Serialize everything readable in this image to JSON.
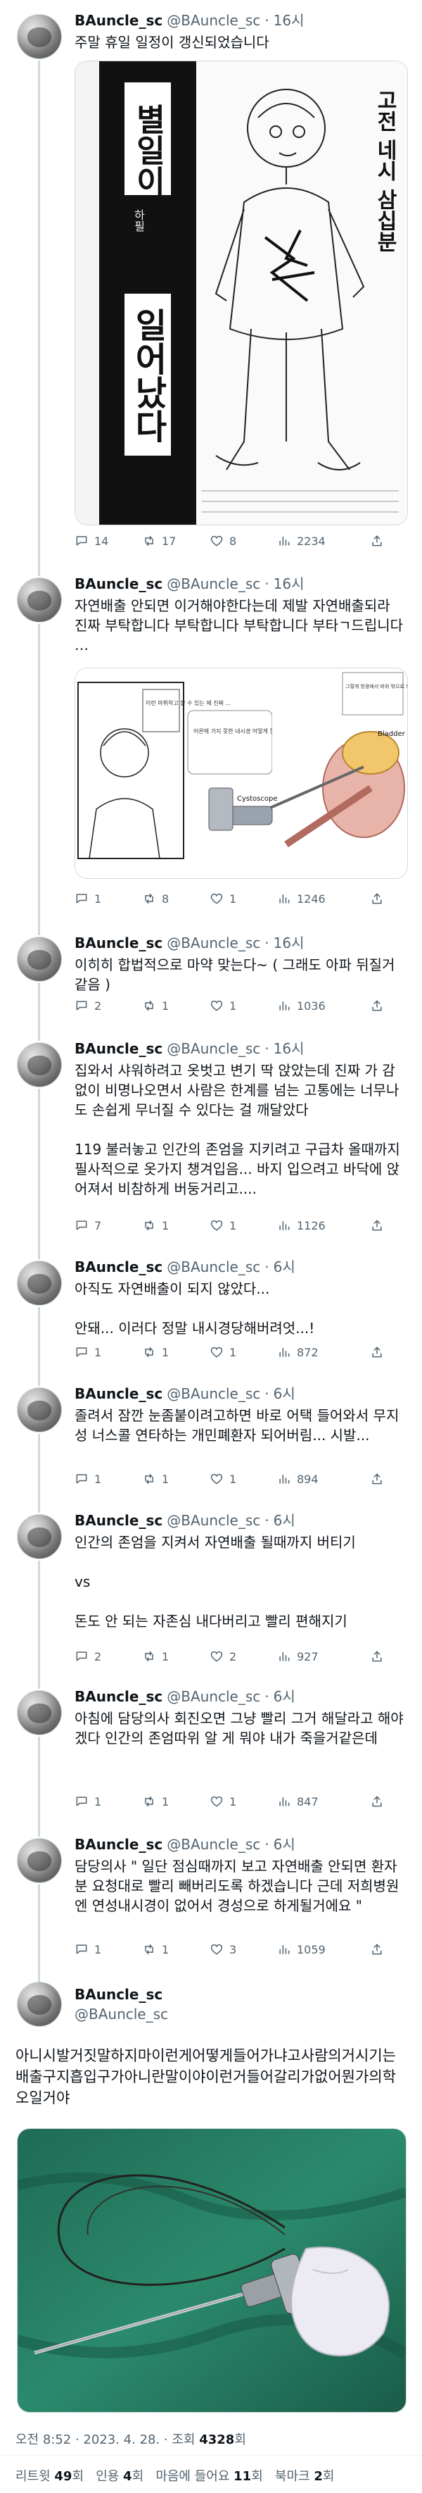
{
  "author": {
    "name": "BAuncle_sc",
    "handle": "@BAuncle_sc"
  },
  "tweets": [
    {
      "time": "16시",
      "text": "주말 휴일 일정이 갱신되었습니다",
      "image": {
        "big_title": "별일이",
        "sub_title": "일어났다",
        "side_text": "고전 네시 삼십분",
        "small_note": "하필"
      },
      "replies": "14",
      "retweets": "17",
      "likes": "8",
      "views": "2234"
    },
    {
      "time": "16시",
      "text": "자연배출 안되면 이거해야한다는데 제발 자연배출되라 진짜 부탁합니다 부탁합니다 부탁합니다 부타ㄱ드립니다 …",
      "image": {
        "panel_text_1": "이런 마취하고 할 수 있는 제 진짜 ...",
        "panel_text_2": "어른에 가지 못한 내시경 어떻게 못 하...",
        "panel_text_3": "그렇게 방광에서 바위 밖으로 퇴석 거려 보는",
        "label_cystoscope": "Cystoscope",
        "label_bladder": "Bladder"
      },
      "replies": "1",
      "retweets": "8",
      "likes": "1",
      "views": "1246"
    },
    {
      "time": "16시",
      "text": "이히히 합법적으로 마약 맞는다~ ( 그래도 아파 뒤질거같음 )",
      "replies": "2",
      "retweets": "1",
      "likes": "1",
      "views": "1036"
    },
    {
      "time": "16시",
      "text": "집와서 샤워하려고 옷벗고 변기 딱 앉았는데 진짜 가 감없이 비명나오면서 사람은 한계를 넘는 고통에는 너무나도 손쉽게 무너질 수 있다는 걸 깨달았다\n\n119 불러놓고 인간의 존엄을 지키려고 구급차 올때까지 필사적으로 옷가지 챙겨입음... 바지 입으려고 바닥에 앉어져서 비참하게 버둥거리고....",
      "replies": "7",
      "retweets": "1",
      "likes": "1",
      "views": "1126"
    },
    {
      "time": "6시",
      "text": "아직도 자연배출이 되지 않았다...\n\n안돼... 이러다 정말 내시경당해버려엇...!",
      "replies": "1",
      "retweets": "1",
      "likes": "1",
      "views": "872"
    },
    {
      "time": "6시",
      "text": "졸려서 잠깐 눈좀붙이려고하면 바로 어택 들어와서 무지성 너스콜 연타하는 개민폐환자 되어버림... 시발...",
      "replies": "1",
      "retweets": "1",
      "likes": "1",
      "views": "894"
    },
    {
      "time": "6시",
      "text": "인간의 존엄을 지켜서 자연배출 될때까지 버티기\n\nvs\n\n돈도 안 되는 자존심 내다버리고 빨리 편해지기",
      "replies": "2",
      "retweets": "1",
      "likes": "2",
      "views": "927"
    },
    {
      "time": "6시",
      "text": "아침에 담당의사 회진오면 그냥 빨리 그거 해달라고 해야겠다 인간의 존엄따위 알 게 뭐야 내가 죽을거같은데",
      "replies": "1",
      "retweets": "1",
      "likes": "1",
      "views": "847"
    },
    {
      "time": "6시",
      "text": "담당의사 \" 일단 점심때까지 보고 자연배출 안되면 환자분 요청대로 빨리 빼버리도록 하겠습니다 근데 저희병원엔 연성내시경이 없어서 경성으로 하게될거에요 \"",
      "replies": "1",
      "retweets": "1",
      "likes": "3",
      "views": "1059"
    }
  ],
  "final": {
    "text": "아니시발거짓말하지마이런게어떻게들어가냐고사람의거시기는배출구지흡입구가아니란말이야이런거들어갈리가없어뭔가의학오일거야",
    "timestamp": "오전 8:52 · 2023. 4. 28. · 조회 ",
    "views_count": "4328",
    "views_suffix": "회",
    "stats": {
      "retweets_label": "리트윗 ",
      "retweets": "49",
      "retweets_unit": "회",
      "quotes_label": "인용 ",
      "quotes": "4",
      "quotes_unit": "회",
      "likes_label": "마음에 들어요 ",
      "likes": "11",
      "likes_unit": "회",
      "bookmarks_label": "북마크 ",
      "bookmarks": "2",
      "bookmarks_unit": "회"
    }
  }
}
